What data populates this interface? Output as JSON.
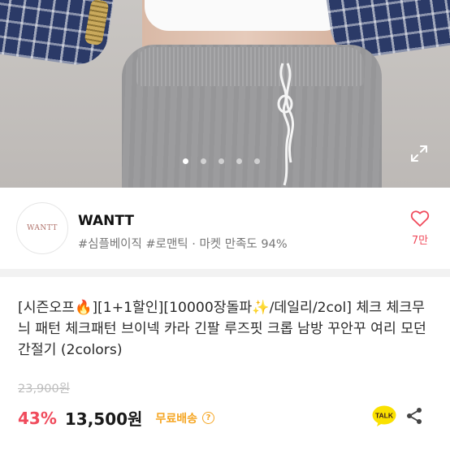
{
  "gallery": {
    "dots": [
      {
        "active": true
      },
      {
        "active": false
      },
      {
        "active": false
      },
      {
        "active": false
      },
      {
        "active": false
      }
    ],
    "expand_icon": "expand-arrows-icon"
  },
  "shop": {
    "logo_text": "WANTT",
    "name": "WANTT",
    "tags": "#심플베이직 #로맨틱 · 마켓 만족도 94%",
    "like_icon": "heart-outline-icon",
    "like_count": "7만"
  },
  "product": {
    "title": "[시즌오프🔥][1+1할인][10000장돌파✨/데일리/2col] 체크 체크무늬 패턴 체크패턴 브이넥 카라 긴팔 루즈핏 크롭 남방 꾸안꾸 여리 모던 간절기 (2colors)",
    "original_price": "23,900원",
    "discount": "43%",
    "price": "13,500원",
    "shipping": "무료배송",
    "shipping_info_icon": "info-icon",
    "kakao_talk_label": "TALK",
    "share_icon": "share-icon"
  },
  "colors": {
    "accent_red": "#f04b5c",
    "shipping_orange": "#f5a623",
    "kakao_yellow": "#fae100"
  }
}
